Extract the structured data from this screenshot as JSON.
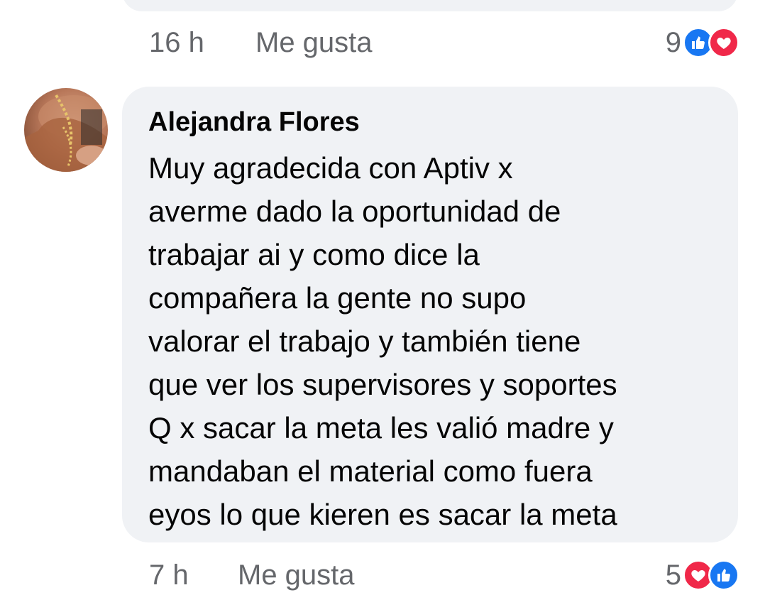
{
  "previous_comment": {
    "time": "16 h",
    "like_label": "Me gusta",
    "reaction_count": "9",
    "reaction_icons": [
      "like-icon",
      "love-icon"
    ]
  },
  "comment": {
    "author": "Alejandra Flores",
    "lines": [
      "Muy agradecida con Aptiv x",
      "averme dado la oportunidad de",
      "trabajar ai y como dice la",
      "compañera la gente no supo",
      "valorar el trabajo y también tiene",
      "que ver los supervisores y soportes",
      "Q x sacar la meta les valió madre y",
      "mandaban el material como fuera",
      "eyos lo que kieren es sacar la meta"
    ],
    "time": "7 h",
    "like_label": "Me gusta",
    "reaction_count": "5",
    "reaction_icons": [
      "love-icon",
      "like-icon"
    ]
  },
  "colors": {
    "bubble": "#f0f2f5",
    "secondary_text": "#65676b",
    "like_blue": "#1877f2",
    "love_red": "#f02849"
  }
}
